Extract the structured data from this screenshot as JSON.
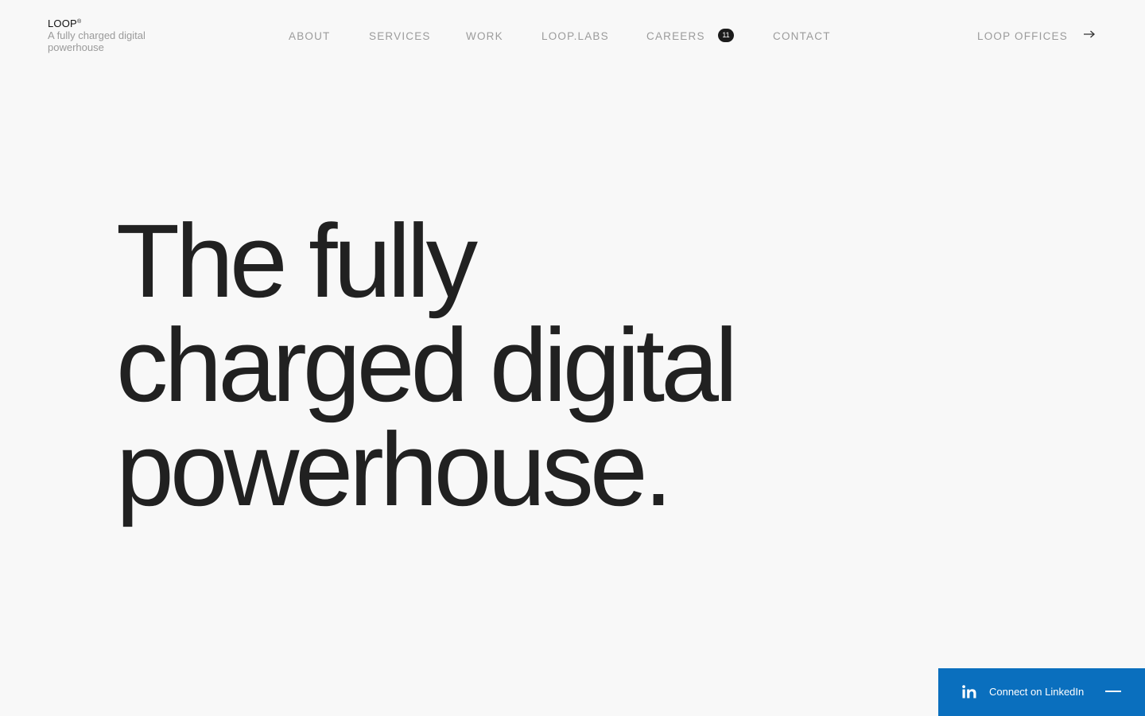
{
  "brand": {
    "name": "LOOP",
    "mark": "®",
    "tagline": "A fully charged digital powerhouse"
  },
  "nav": {
    "items": [
      {
        "label": "ABOUT"
      },
      {
        "label": "SERVICES"
      },
      {
        "label": "WORK"
      },
      {
        "label": "LOOP.LABS"
      },
      {
        "label": "CAREERS"
      },
      {
        "label": "CONTACT"
      }
    ],
    "careers_badge": "11",
    "offices_label": "LOOP OFFICES",
    "offices_icon": "arrow-right-icon"
  },
  "hero": {
    "line1": "The fully",
    "line2_start": "charged ",
    "line2_emph": "digital",
    "line3": "powerhouse."
  },
  "linkedin_widget": {
    "label": "Connect on LinkedIn",
    "icon": "linkedin-icon",
    "color": "#0a6fbe"
  },
  "colors": {
    "background": "#f8f8f8",
    "text": "#212121",
    "nav": "#9b9b9b"
  }
}
